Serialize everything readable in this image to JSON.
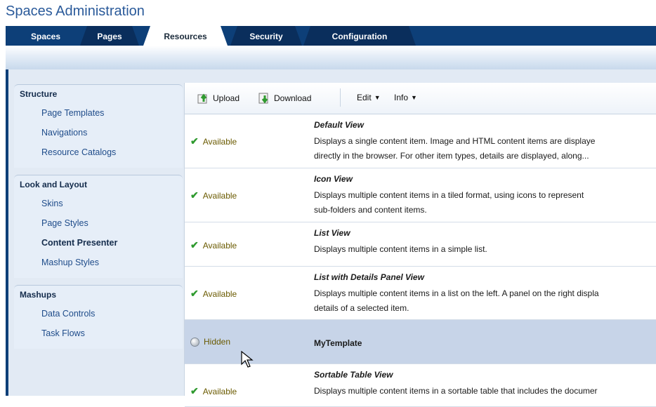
{
  "app_title": "Spaces Administration",
  "tabs": [
    {
      "label": "Spaces"
    },
    {
      "label": "Pages"
    },
    {
      "label": "Resources"
    },
    {
      "label": "Security"
    },
    {
      "label": "Configuration"
    }
  ],
  "sidebar": {
    "groups": [
      {
        "title": "Structure",
        "items": [
          "Page Templates",
          "Navigations",
          "Resource Catalogs"
        ]
      },
      {
        "title": "Look and Layout",
        "items": [
          "Skins",
          "Page Styles",
          "Content Presenter",
          "Mashup Styles"
        ]
      },
      {
        "title": "Mashups",
        "items": [
          "Data Controls",
          "Task Flows"
        ]
      }
    ]
  },
  "toolbar": {
    "upload": "Upload",
    "download": "Download",
    "edit": "Edit",
    "info": "Info"
  },
  "rows": [
    {
      "status": "Available",
      "name": "Default View",
      "desc": "Displays a single content item. Image and HTML content items are displaye\ndirectly in the browser. For other item types, details are displayed, along..."
    },
    {
      "status": "Available",
      "name": "Icon View",
      "desc": "Displays multiple content items in a tiled format, using icons to represent\nsub-folders and content items."
    },
    {
      "status": "Available",
      "name": "List View",
      "desc": "Displays multiple content items in a simple list."
    },
    {
      "status": "Available",
      "name": "List with Details Panel View",
      "desc": "Displays multiple content items in a list on the left. A panel on the right displa\ndetails of a selected item."
    },
    {
      "status": "Hidden",
      "name": "MyTemplate",
      "desc": ""
    },
    {
      "status": "Available",
      "name": "Sortable Table View",
      "desc": "Displays multiple content items in a sortable table that includes the documer"
    }
  ],
  "colors": {
    "brand": "#0d3f78",
    "link": "#1f4c8a",
    "selected_row": "#c7d4e8",
    "check": "#2f9a2f"
  }
}
